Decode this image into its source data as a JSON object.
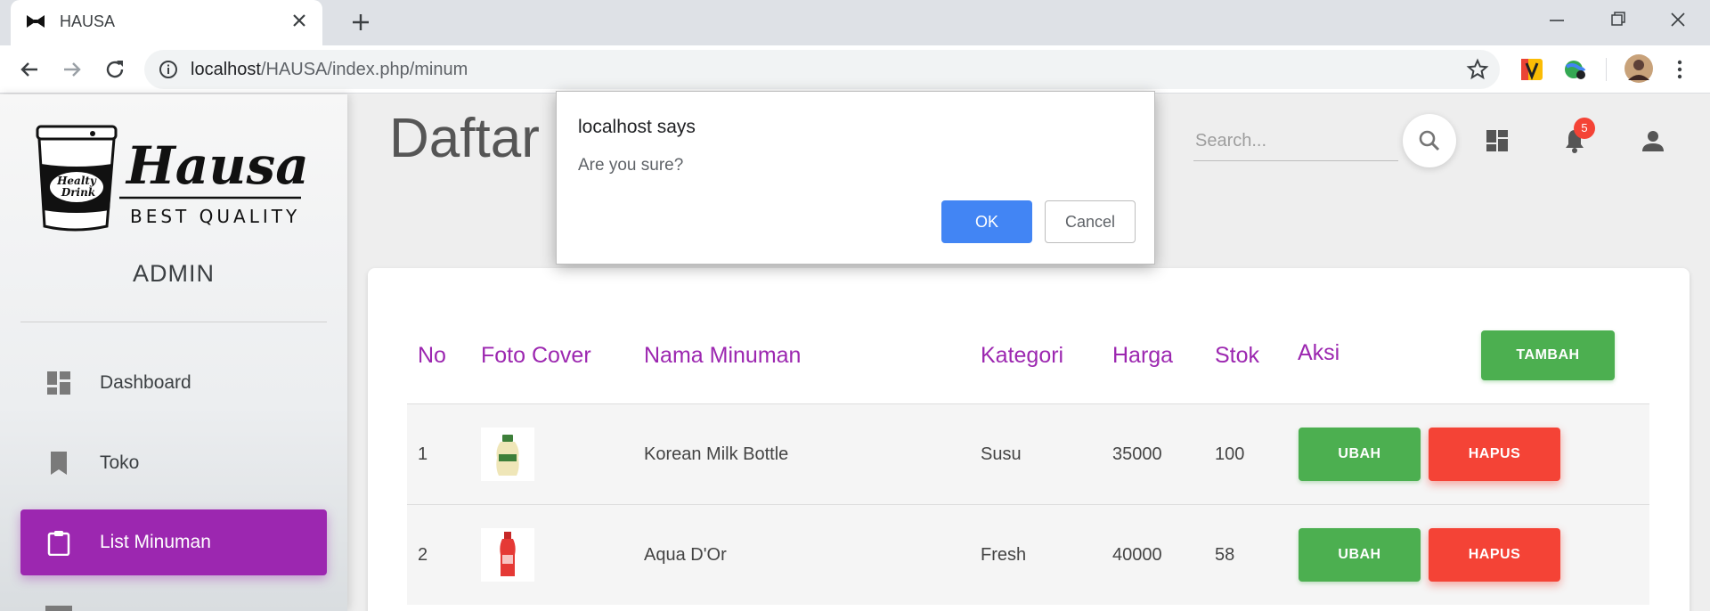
{
  "browser": {
    "tab_title": "HAUSA",
    "url_host": "localhost",
    "url_path": "/HAUSA/index.php/minum"
  },
  "sidebar": {
    "logo_name": "Hausa",
    "logo_tagline": "BEST QUALITY",
    "logo_badge": "Healty Drink",
    "role": "ADMIN",
    "items": [
      {
        "label": "Dashboard",
        "icon": "dashboard-icon",
        "active": false
      },
      {
        "label": "Toko",
        "icon": "bookmark-icon",
        "active": false
      },
      {
        "label": "List Minuman",
        "icon": "clipboard-icon",
        "active": true
      }
    ]
  },
  "header": {
    "title": "Daftar M",
    "search_placeholder": "Search...",
    "notification_count": "5"
  },
  "table": {
    "columns": [
      "No",
      "Foto Cover",
      "Nama Minuman",
      "Kategori",
      "Harga",
      "Stok",
      "Aksi"
    ],
    "add_label": "TAMBAH",
    "edit_label": "UBAH",
    "delete_label": "HAPUS",
    "rows": [
      {
        "no": "1",
        "name": "Korean Milk Bottle",
        "category": "Susu",
        "price": "35000",
        "stock": "100"
      },
      {
        "no": "2",
        "name": "Aqua D'Or",
        "category": "Fresh",
        "price": "40000",
        "stock": "58"
      }
    ]
  },
  "dialog": {
    "title": "localhost says",
    "message": "Are you sure?",
    "ok_label": "OK",
    "cancel_label": "Cancel"
  },
  "colors": {
    "accent": "#9c27b0",
    "success": "#4caf50",
    "danger": "#f44336",
    "dialog_ok": "#4285f4"
  }
}
